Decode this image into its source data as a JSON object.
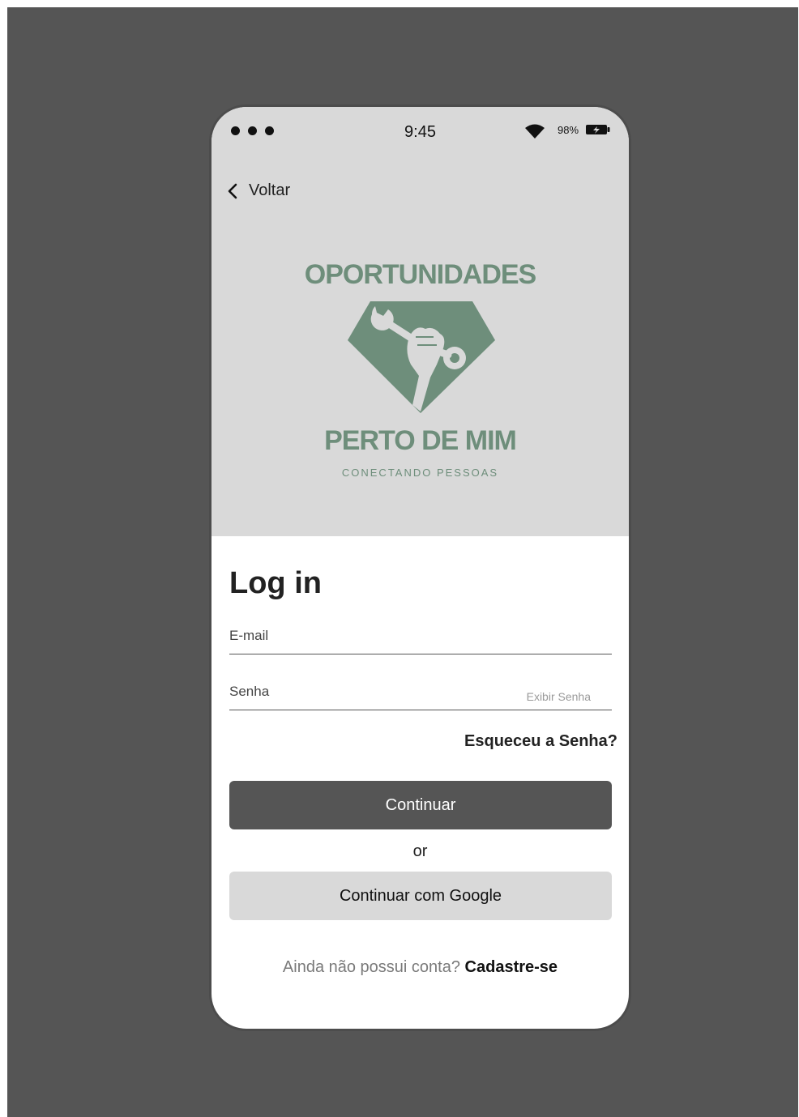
{
  "status_bar": {
    "time": "9:45",
    "battery_percent": "98%",
    "icons": [
      "signal-dots-icon",
      "wifi-icon",
      "battery-charging-icon"
    ]
  },
  "nav": {
    "back_label": "Voltar",
    "back_icon": "chevron-left-icon"
  },
  "logo": {
    "top_text": "OPORTUNIDADES",
    "bottom_text": "PERTO DE MIM",
    "tagline": "CONECTANDO PESSOAS",
    "icon": "hand-wrench-gem-icon",
    "color": "#6e8e7b"
  },
  "login": {
    "title": "Log in",
    "email_placeholder": "E-mail",
    "password_placeholder": "Senha",
    "show_password": "Exibir Senha",
    "forgot_password": "Esqueceu a Senha?",
    "continue_label": "Continuar",
    "or_label": "or",
    "google_label": "Continuar com Google",
    "signup_question": "Ainda não possui conta?",
    "signup_link": "Cadastre-se"
  },
  "colors": {
    "background": "#555555",
    "panel": "#d9d9d9",
    "primary_button": "#555555",
    "secondary_button": "#d9d9d9",
    "accent": "#6e8e7b"
  }
}
